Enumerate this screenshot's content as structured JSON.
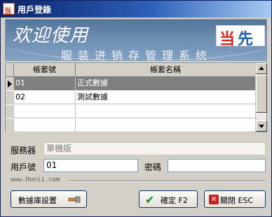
{
  "window": {
    "title": "用戶登錄",
    "app_icon_glyph": "当"
  },
  "banner": {
    "welcome": "欢迎使用",
    "tagline": "服装进销存管理系统",
    "logo_left": "当",
    "logo_right": "先"
  },
  "grid": {
    "columns": [
      "帳套號",
      "帳套名稱"
    ],
    "rows": [
      {
        "id": "01",
        "name": "正式數據",
        "selected": true
      },
      {
        "id": "02",
        "name": "測試數據",
        "selected": false
      },
      {
        "id": "",
        "name": "",
        "selected": false
      },
      {
        "id": "",
        "name": "",
        "selected": false
      }
    ]
  },
  "form": {
    "server_label": "服務器",
    "server_value": "單機版",
    "user_label": "用戶號",
    "user_value": "01",
    "password_label": "密碼",
    "password_value": ""
  },
  "footer": {
    "url": "www.Honii.com"
  },
  "buttons": {
    "db_settings": "數據庫設置",
    "ok": "確定 F2",
    "close": "關閉 ESC"
  },
  "icons": {
    "app": "app-icon",
    "tool": "wrench-icon",
    "ok": "check-icon",
    "close": "close-icon"
  },
  "colors": {
    "titlebar": "#0a246a",
    "selected_row": "#808080",
    "logo_red": "#d7261f",
    "logo_blue": "#1f5fb4"
  }
}
